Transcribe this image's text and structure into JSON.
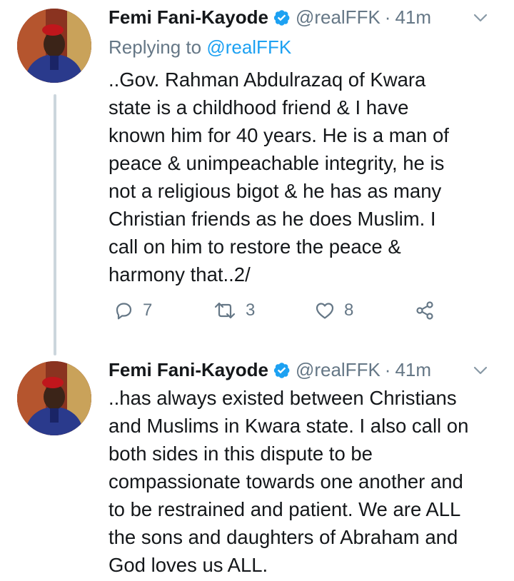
{
  "tweets": [
    {
      "author": {
        "name": "Femi Fani-Kayode",
        "handle": "@realFFK"
      },
      "separator": "·",
      "time": "41m",
      "replying_to_prefix": "Replying to ",
      "replying_to_handle": "@realFFK",
      "lines": [
        "..Gov. Rahman Abdulrazaq of Kwara",
        "state is a childhood friend & I have",
        "known him for 40 years. He is a man of",
        "peace & unimpeachable integrity, he is",
        "not a religious bigot & he has as many",
        "Christian friends as he does Muslim. I",
        "call on him to restore the peace &",
        "harmony that..2/"
      ],
      "actions": {
        "replies": "7",
        "retweets": "3",
        "likes": "8"
      }
    },
    {
      "author": {
        "name": "Femi Fani-Kayode",
        "handle": "@realFFK"
      },
      "separator": "·",
      "time": "41m",
      "lines": [
        "..has always existed between Christians",
        "and Muslims in Kwara state. I also call on",
        "both sides in this dispute to be",
        "compassionate towards one another and",
        "to be restrained and patient. We are ALL",
        "the sons and daughters of Abraham and",
        "God loves us ALL."
      ]
    }
  ],
  "colors": {
    "accent": "#1da1f2",
    "secondary_text": "#657786",
    "text": "#14171a",
    "thread_line": "#ccd6dd"
  },
  "icons": [
    "verified-badge-icon",
    "chevron-down-icon",
    "reply-icon",
    "retweet-icon",
    "like-icon",
    "share-icon"
  ]
}
